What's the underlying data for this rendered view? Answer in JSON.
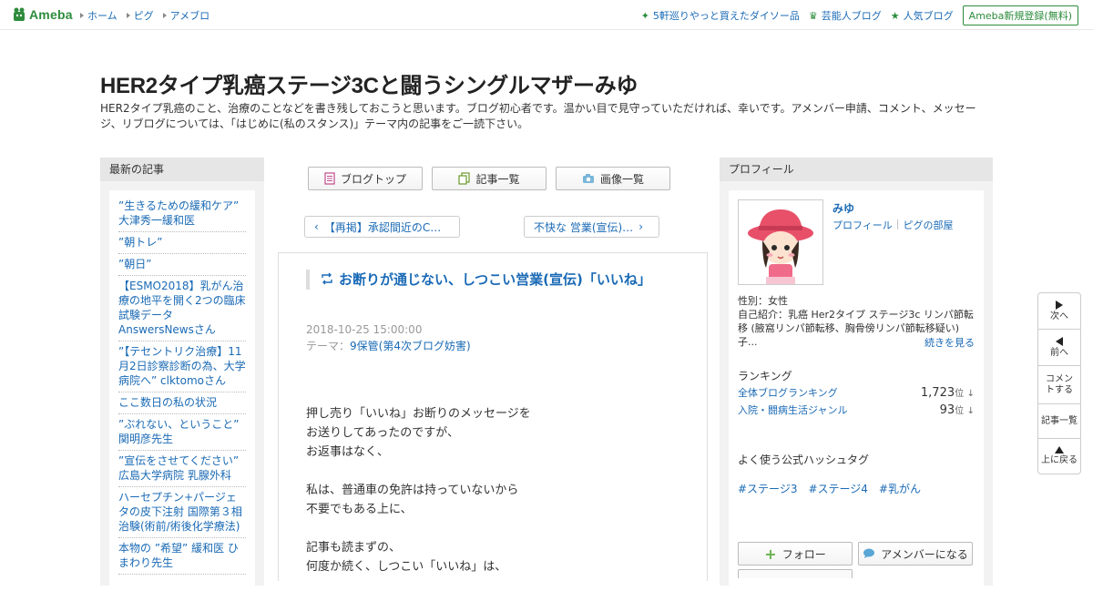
{
  "topbar": {
    "logo_text": "Ameba",
    "nav": [
      "ホーム",
      "ピグ",
      "アメブロ"
    ],
    "right_links": [
      {
        "label": "5軒巡りやっと買えたダイソー品",
        "icon": "sparkle-icon"
      },
      {
        "label": "芸能人ブログ",
        "icon": "crown-icon"
      },
      {
        "label": "人気ブログ",
        "icon": "star-icon"
      }
    ],
    "signup_label": "Ameba新規登録(無料)"
  },
  "header": {
    "title": "HER2タイプ乳癌ステージ3Cと闘うシングルマザーみゆ",
    "description": "HER2タイプ乳癌のこと、治療のことなどを書き残しておこうと思います。ブログ初心者です。温かい目で見守っていただければ、幸いです。アメンバー申請、コメント、メッセージ、リブログについては、「はじめに(私のスタンス)」テーマ内の記事をご一読下さい。"
  },
  "left_sidebar": {
    "heading": "最新の記事",
    "entries": [
      "”生きるための緩和ケア” 大津秀一緩和医",
      "”朝トレ”",
      "”朝日”",
      "【ESMO2018】乳がん治療の地平を開く2つの臨床試験データAnswersNewsさん",
      "”【テセントリク治療】11月2日診察診断の為、大学病院へ” clktomoさん",
      "ここ数日の私の状況",
      "”ぶれない、ということ” 関明彦先生",
      "”宣伝をさせてください” 広島大学病院 乳腺外科",
      "ハーセプチン+パージェタの皮下注射 国際第３相治験(術前/術後化学療法)",
      "本物の ”希望” 緩和医 ひまわり先生"
    ]
  },
  "center": {
    "nav_buttons": [
      {
        "label": "ブログトップ",
        "icon": "document-icon"
      },
      {
        "label": "記事一覧",
        "icon": "copy-icon"
      },
      {
        "label": "画像一覧",
        "icon": "camera-icon"
      }
    ],
    "prev_label": "【再掲】承認間近のC…",
    "next_label": "不快な 営業(宣伝)…",
    "article": {
      "title": "お断りが通じない、しつこい営業(宣伝)「いいね」",
      "date": "2018-10-25 15:00:00",
      "theme_prefix": "テーマ：",
      "theme": "9保管(第4次ブログ妨害)",
      "body": [
        "押し売り「いいね」お断りのメッセージを",
        "お送りしてあったのですが、",
        "お返事はなく、",
        "",
        "私は、普通車の免許は持っていないから",
        "不要でもある上に、",
        "",
        "記事も読まずの、",
        "何度か続く、しつこい「いいね」は、"
      ]
    }
  },
  "right_sidebar": {
    "heading": "プロフィール",
    "name": "みゆ",
    "links": [
      "プロフィール",
      "ピグの部屋"
    ],
    "gender": "性別：女性",
    "intro": "自己紹介：乳癌 Her2タイプ ステージ3c リンパ節転移 (腋窩リンパ節転移、胸骨傍リンパ節転移疑い) 子...",
    "read_more": "続きを見る",
    "ranking_heading": "ランキング",
    "rankings": [
      {
        "label": "全体ブログランキング",
        "value": "1,723",
        "unit": "位",
        "trend": "↓"
      },
      {
        "label": "入院・闘病生活ジャンル",
        "value": "93",
        "unit": "位",
        "trend": "↓"
      }
    ],
    "hashtag_heading": "よく使う公式ハッシュタグ",
    "hashtags": [
      "#ステージ3",
      "#ステージ4",
      "#乳がん"
    ],
    "follow_label": "フォロー",
    "amember_label": "アメンバーになる"
  },
  "float_nav": {
    "next": "次へ",
    "prev": "前へ",
    "comment": "コメントする",
    "list": "記事一覧",
    "top": "上に戻る"
  },
  "colors": {
    "brand": "#2d8c3c",
    "link": "#1a6ab5",
    "sidebar_bg": "#f2f2f2"
  }
}
